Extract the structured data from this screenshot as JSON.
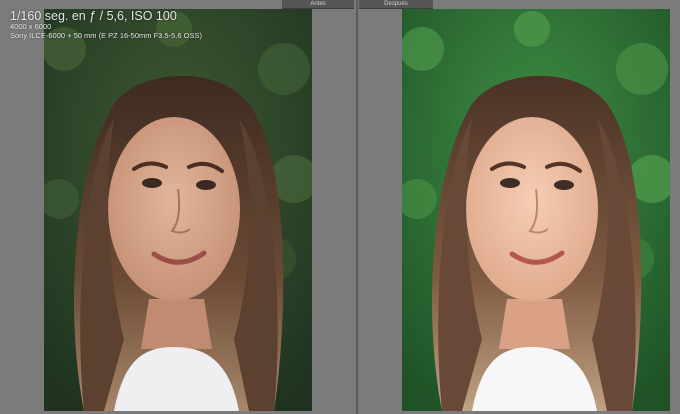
{
  "panes": {
    "before_label": "Antes",
    "after_label": "Después"
  },
  "info": {
    "exposure": "1/160 seg. en ƒ / 5,6, ISO 100",
    "dimensions": "4000 x 6000",
    "camera": "Sony ILCE-6000 + 50 mm (E PZ 16-50mm F3.5-5.6 OSS)"
  },
  "colors": {
    "background": "#7b7b7b",
    "before_foliage": "#2f4d2a",
    "after_foliage": "#2f7a34",
    "before_skin": "#d7a98f",
    "after_skin": "#efc1a6",
    "hair": "#5a3c2c"
  }
}
